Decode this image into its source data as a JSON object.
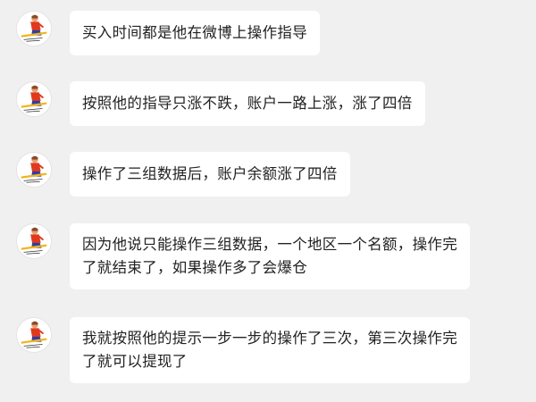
{
  "messages": [
    {
      "avatar_icon": "skier-avatar-icon",
      "lines": [
        "买入时间都是他在微博上操作指导"
      ]
    },
    {
      "avatar_icon": "skier-avatar-icon",
      "lines": [
        "按照他的指导只涨不跌，账户一路上涨，涨了四倍"
      ]
    },
    {
      "avatar_icon": "skier-avatar-icon",
      "lines": [
        "操作了三组数据后，账户余额涨了四倍"
      ]
    },
    {
      "avatar_icon": "skier-avatar-icon",
      "lines": [
        "因为他说只能操作三组数据，一个地区一个名额，操作完",
        "了就结束了，如果操作多了会爆仓"
      ]
    },
    {
      "avatar_icon": "skier-avatar-icon",
      "lines": [
        "我就按照他的提示一步一步的操作了三次，第三次操作完",
        "了就可以提现了"
      ]
    }
  ],
  "colors": {
    "background": "#f0f0f0",
    "bubble": "#ffffff",
    "text": "#222222"
  }
}
